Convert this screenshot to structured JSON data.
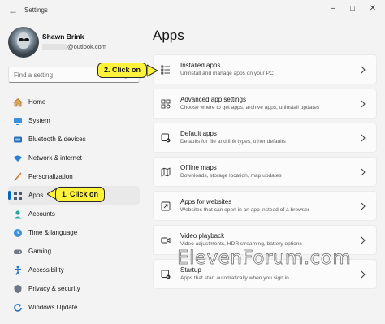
{
  "window": {
    "title": "Settings"
  },
  "user": {
    "name": "Shawn Brink",
    "email": "@outlook.com"
  },
  "search": {
    "placeholder": "Find a setting"
  },
  "nav": {
    "items": [
      {
        "label": "Home",
        "icon": "home-icon"
      },
      {
        "label": "System",
        "icon": "monitor-icon"
      },
      {
        "label": "Bluetooth & devices",
        "icon": "bluetooth-icon"
      },
      {
        "label": "Network & internet",
        "icon": "wifi-icon"
      },
      {
        "label": "Personalization",
        "icon": "brush-icon"
      },
      {
        "label": "Apps",
        "icon": "apps-icon",
        "active": true
      },
      {
        "label": "Accounts",
        "icon": "person-icon"
      },
      {
        "label": "Time & language",
        "icon": "globe-clock-icon"
      },
      {
        "label": "Gaming",
        "icon": "gamepad-icon"
      },
      {
        "label": "Accessibility",
        "icon": "accessibility-icon"
      },
      {
        "label": "Privacy & security",
        "icon": "shield-icon"
      },
      {
        "label": "Windows Update",
        "icon": "update-icon"
      }
    ]
  },
  "page": {
    "title": "Apps"
  },
  "cards": [
    {
      "title": "Installed apps",
      "subtitle": "Uninstall and manage apps on your PC",
      "icon": "installed-apps-icon"
    },
    {
      "title": "Advanced app settings",
      "subtitle": "Choose where to get apps, archive apps, uninstall updates",
      "icon": "advanced-settings-icon"
    },
    {
      "title": "Default apps",
      "subtitle": "Defaults for file and link types, other defaults",
      "icon": "default-apps-icon"
    },
    {
      "title": "Offline maps",
      "subtitle": "Downloads, storage location, map updates",
      "icon": "map-icon"
    },
    {
      "title": "Apps for websites",
      "subtitle": "Websites that can open in an app instead of a browser",
      "icon": "web-apps-icon"
    },
    {
      "title": "Video playback",
      "subtitle": "Video adjustments, HDR streaming, battery options",
      "icon": "video-icon"
    },
    {
      "title": "Startup",
      "subtitle": "Apps that start automatically when you sign in",
      "icon": "startup-icon"
    }
  ],
  "callouts": {
    "step1": "1. Click on",
    "step2": "2. Click on"
  },
  "watermark": "ElevenForum.com",
  "colors": {
    "accent": "#0067c0",
    "callout": "#fff23a",
    "background": "#f3f3f3"
  }
}
